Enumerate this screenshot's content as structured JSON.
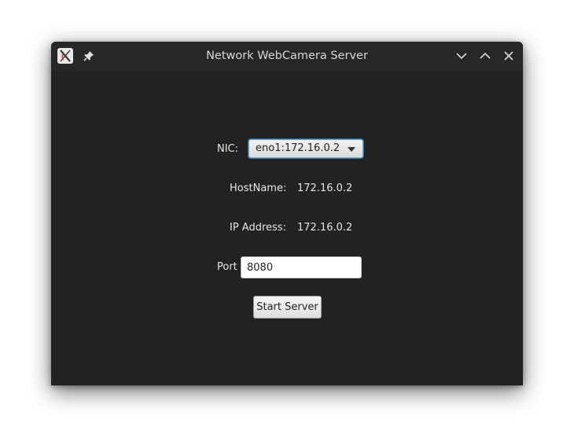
{
  "window": {
    "title": "Network WebCamera Server",
    "icons": {
      "app": "app-x-icon",
      "pin": "pin-icon",
      "minimize": "chevron-down-icon",
      "maximize": "chevron-up-icon",
      "close": "close-icon"
    }
  },
  "form": {
    "nic_label": "NIC:",
    "nic_selected": "eno1:172.16.0.2",
    "hostname_label": "HostName:",
    "hostname_value": "172.16.0.2",
    "ip_label": "IP Address:",
    "ip_value": "172.16.0.2",
    "port_label": "Port",
    "port_value": "8080",
    "start_button": "Start Server"
  },
  "colors": {
    "window_bg": "#222222",
    "titlebar_bg": "#272727",
    "text": "#e6e6e6",
    "focus": "#2f6f9c"
  }
}
